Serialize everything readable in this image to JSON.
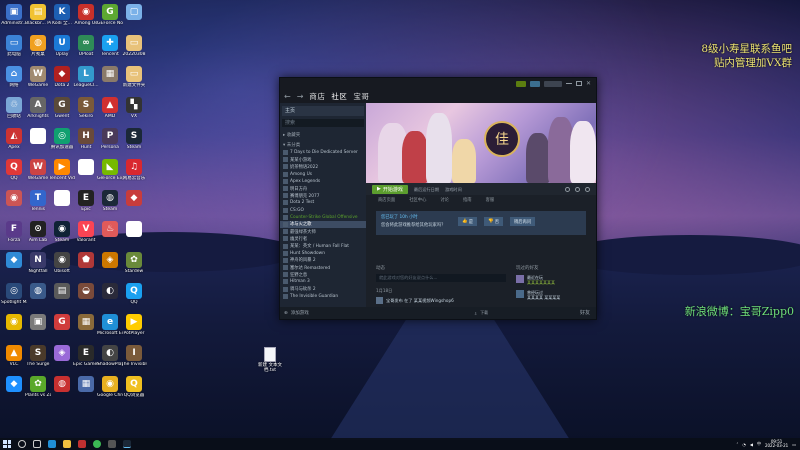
{
  "desktop": {
    "icons": [
      {
        "label": "Administr...",
        "color": "#3a6fc8",
        "glyph": "▣"
      },
      {
        "label": "Blackbr... Pictures",
        "color": "#f1c232",
        "glyph": "▤"
      },
      {
        "label": "Kodi 全...",
        "color": "#1d5fb3",
        "glyph": "K"
      },
      {
        "label": "Among Us",
        "color": "#c8302a",
        "glyph": "◉"
      },
      {
        "label": "GEForce Now",
        "color": "#5da832",
        "glyph": "G"
      },
      {
        "label": "",
        "color": "#7bb1e8",
        "glyph": "▢"
      },
      {
        "label": "此电脑",
        "color": "#3b82d6",
        "glyph": "▭"
      },
      {
        "label": "片笺桌",
        "color": "#f0a020",
        "glyph": "◍"
      },
      {
        "label": "Uplay",
        "color": "#1b7ad6",
        "glyph": "U"
      },
      {
        "label": "UPIoat",
        "color": "#2e8b57",
        "glyph": "∞"
      },
      {
        "label": "Tencent",
        "color": "#1aa0f0",
        "glyph": "✚"
      },
      {
        "label": "20220308",
        "color": "#e8c27a",
        "glyph": "▭"
      },
      {
        "label": "网络",
        "color": "#4a90e2",
        "glyph": "⌂"
      },
      {
        "label": "WeGame",
        "color": "#a08a70",
        "glyph": "W"
      },
      {
        "label": "Dota 2",
        "color": "#b02020",
        "glyph": "◆"
      },
      {
        "label": "LeagueCl...",
        "color": "#3399cc",
        "glyph": "L"
      },
      {
        "label": "",
        "color": "#8a7a6a",
        "glyph": "▦"
      },
      {
        "label": "新建文件夹",
        "color": "#e8c27a",
        "glyph": "▭"
      },
      {
        "label": "回收站",
        "color": "#7aa7d6",
        "glyph": "♲"
      },
      {
        "label": "Arknights",
        "color": "#666666",
        "glyph": "A"
      },
      {
        "label": "Gwent",
        "color": "#5a4a3a",
        "glyph": "G"
      },
      {
        "label": "Sekiro",
        "color": "#7a5a3a",
        "glyph": "S"
      },
      {
        "label": "AMD",
        "color": "#d03030",
        "glyph": "▲"
      },
      {
        "label": "VX",
        "color": "#333333",
        "glyph": "▚"
      },
      {
        "label": "Apex",
        "color": "#cc3333",
        "glyph": "◭"
      },
      {
        "label": "",
        "color": "#ffffff",
        "glyph": "▯"
      },
      {
        "label": "腾讯加速器",
        "color": "#10a070",
        "glyph": "◎"
      },
      {
        "label": "Hunt",
        "color": "#6a4a3a",
        "glyph": "H"
      },
      {
        "label": "Persona",
        "color": "#4a3a5a",
        "glyph": "P"
      },
      {
        "label": "Steam",
        "color": "#1b2838",
        "glyph": "S"
      },
      {
        "label": "QQ",
        "color": "#e03838",
        "glyph": "Q"
      },
      {
        "label": "WeGame",
        "color": "#cc4444",
        "glyph": "W"
      },
      {
        "label": "Tencent Video",
        "color": "#ff8800",
        "glyph": "▶"
      },
      {
        "label": "",
        "color": "#ffffff",
        "glyph": "▯"
      },
      {
        "label": "GeForce Experience",
        "color": "#76b900",
        "glyph": "◣"
      },
      {
        "label": "网易云音乐",
        "color": "#d9282f",
        "glyph": "♫"
      },
      {
        "label": "",
        "color": "#cc5555",
        "glyph": "◉"
      },
      {
        "label": "Tennis",
        "color": "#3366cc",
        "glyph": "T"
      },
      {
        "label": "",
        "color": "#ffffff",
        "glyph": "▯"
      },
      {
        "label": "Epic",
        "color": "#222222",
        "glyph": "E"
      },
      {
        "label": "Steam",
        "color": "#1b2838",
        "glyph": "◍"
      },
      {
        "label": "",
        "color": "#c83c3c",
        "glyph": "◆"
      },
      {
        "label": "Forza",
        "color": "#5a3a8a",
        "glyph": "F"
      },
      {
        "label": "Aim Lab",
        "color": "#222222",
        "glyph": "⊙"
      },
      {
        "label": "Steam",
        "color": "#0f2235",
        "glyph": "◉"
      },
      {
        "label": "Valorant",
        "color": "#fa4454",
        "glyph": "V"
      },
      {
        "label": "",
        "color": "#e05a5a",
        "glyph": "♨"
      },
      {
        "label": "",
        "color": "#ffffff",
        "glyph": "▯"
      },
      {
        "label": "",
        "color": "#2f8bd6",
        "glyph": "◆"
      },
      {
        "label": "Nightfall",
        "color": "#3a3a6a",
        "glyph": "N"
      },
      {
        "label": "Ubisoft",
        "color": "#444444",
        "glyph": "◉"
      },
      {
        "label": "",
        "color": "#b03838",
        "glyph": "⬟"
      },
      {
        "label": "",
        "color": "#cc7700",
        "glyph": "◈"
      },
      {
        "label": "Stardew",
        "color": "#6a8a3a",
        "glyph": "✿"
      },
      {
        "label": "Spotlight Manager",
        "color": "#2a4a7a",
        "glyph": "◎"
      },
      {
        "label": "",
        "color": "#3a5a8a",
        "glyph": "◍"
      },
      {
        "label": "",
        "color": "#5a5a5a",
        "glyph": "▤"
      },
      {
        "label": "",
        "color": "#7a4a3a",
        "glyph": "◒"
      },
      {
        "label": "",
        "color": "#2a2a3a",
        "glyph": "◐"
      },
      {
        "label": "QQ",
        "color": "#1aa0f0",
        "glyph": "Q"
      },
      {
        "label": "",
        "color": "#e6b800",
        "glyph": "◉"
      },
      {
        "label": "",
        "color": "#7a7a7a",
        "glyph": "▣"
      },
      {
        "label": "",
        "color": "#d03c3c",
        "glyph": "G"
      },
      {
        "label": "",
        "color": "#8a6a3a",
        "glyph": "▦"
      },
      {
        "label": "Microsoft Edge",
        "color": "#1f8fd6",
        "glyph": "e"
      },
      {
        "label": "PotPlayer",
        "color": "#ffcc00",
        "glyph": "▶"
      },
      {
        "label": "VLC",
        "color": "#f08a00",
        "glyph": "▲"
      },
      {
        "label": "The Surge",
        "color": "#4a3a2a",
        "glyph": "S"
      },
      {
        "label": "",
        "color": "#9a6ad8",
        "glyph": "◈"
      },
      {
        "label": "Epic Games Launcher",
        "color": "#2a2a2a",
        "glyph": "E"
      },
      {
        "label": "ShadowPlay",
        "color": "#444444",
        "glyph": "◐"
      },
      {
        "label": "The Invisible",
        "color": "#7a5a3a",
        "glyph": "I"
      },
      {
        "label": "",
        "color": "#1e90ff",
        "glyph": "◆"
      },
      {
        "label": "Plants vs Zombies",
        "color": "#5aa82a",
        "glyph": "✿"
      },
      {
        "label": "",
        "color": "#c83030",
        "glyph": "◍"
      },
      {
        "label": "",
        "color": "#4a6aa8",
        "glyph": "▦"
      },
      {
        "label": "Google Chrome",
        "color": "#e8b020",
        "glyph": "◉"
      },
      {
        "label": "QQ浏览器",
        "color": "#f0c020",
        "glyph": "Q"
      },
      {
        "label": "OBS Studio",
        "color": "#333333",
        "glyph": "◎"
      },
      {
        "label": "新建 Text Document",
        "color": "#eeeeee",
        "glyph": "▯"
      },
      {
        "label": "",
        "color": "#3a3a3a",
        "glyph": "◆"
      },
      {
        "label": "",
        "color": "#7a3aaa",
        "glyph": "◈"
      },
      {
        "label": "",
        "color": "#2a2a2a",
        "glyph": "◐"
      },
      {
        "label": "",
        "color": "#aa8a3a",
        "glyph": "⚔"
      },
      {
        "label": "",
        "color": "#cc3333",
        "glyph": "◍"
      }
    ],
    "file": {
      "label": "新建 文本文 档.txt"
    }
  },
  "overlay": {
    "line1": "8级小寿星联系鱼吧",
    "line2": "贴内管理加VX群",
    "weibo": "新浪微博：宝哥Zipp0"
  },
  "steam": {
    "nav": {
      "back": "←",
      "forward": "→",
      "tab_store": "商店",
      "tab_library": "社区",
      "tab_profile": "宝哥"
    },
    "sidebar": {
      "home": "主页",
      "search": "搜索",
      "section_favorites": "▸ 收藏夹",
      "section_uncategorized": "▾ 未分类",
      "items": [
        "7 Days to Die Dedicated Server",
        "某某小游戏",
        "奶茶物语2022",
        "Among Us",
        "Apex Legends",
        "明日方舟",
        "赛博朋克 2077",
        "Dota 2 Test",
        "CS:GO",
        "Counter-Strike Global Offensive",
        "冰与火之歌",
        "最强绿茶大师",
        "幽灵行者",
        "某某：英文 / Human Fall Flat",
        "Hunt Showdown",
        "神舟的风暴 2",
        "塞尔达 Remastered",
        "狂野之息",
        "Hitman 3",
        "骑马与砍杀 2",
        "The Invisible Guardian"
      ],
      "selected_index": 10,
      "footer": "添加游戏"
    },
    "game": {
      "logo_text": "佳",
      "play_label": "开始游戏",
      "meta_lines": [
        "最后运行日期",
        "游戏时间"
      ],
      "subnav": [
        "商店页面",
        "社区中心",
        "讨论",
        "指南",
        "客服"
      ],
      "review_q1": "您已玩了 10h 小时",
      "review_q2": "您会将此游戏推荐给其他玩家吗？",
      "review_yes": "是",
      "review_no": "否",
      "review_later": "稍后再问"
    },
    "activity": {
      "title": "动态",
      "placeholder": "就此游戏对您的好友说点什么...",
      "date": "1月18日",
      "row_text": "宝哥发布 在了 某某视频Wingshop6"
    },
    "friends": {
      "title": "玩过的好友",
      "entries": [
        {
          "name": "最近在玩",
          "detail": "某某某某某某某"
        },
        {
          "name": "曾经玩过",
          "detail": "某某某某 某某某某"
        }
      ]
    },
    "footer": "下载",
    "footer_right": "好友"
  },
  "taskbar": {
    "time": "09:51",
    "date": "2022-03-21"
  }
}
